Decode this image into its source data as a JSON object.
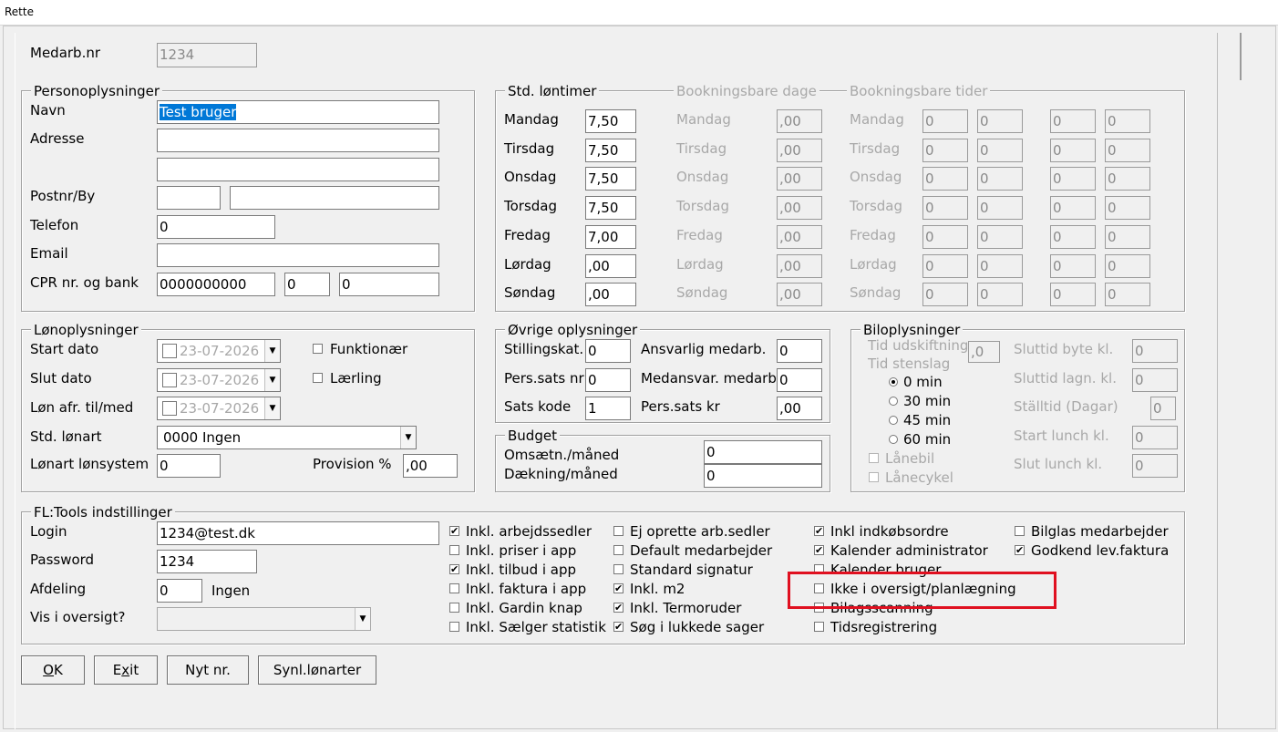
{
  "window": {
    "title": "Rette"
  },
  "header": {
    "medarb_label": "Medarb.nr",
    "medarb_value": "1234"
  },
  "person": {
    "title": "Personoplysninger",
    "navn_label": "Navn",
    "navn_value": "Test bruger",
    "adresse_label": "Adresse",
    "adresse1": "",
    "adresse2": "",
    "postnr_label": "Postnr/By",
    "postnr": "",
    "by": "",
    "telefon_label": "Telefon",
    "telefon": "0",
    "email_label": "Email",
    "email": "",
    "cpr_label": "CPR nr. og bank",
    "cpr": "0000000000",
    "bank1": "0",
    "bank2": "0"
  },
  "std": {
    "title": "Std. løntimer",
    "booking_days_title": "Bookningsbare dage",
    "booking_times_title": "Bookningsbare tider",
    "days": [
      {
        "label": "Mandag",
        "hours": "7,50",
        "book": ",00"
      },
      {
        "label": "Tirsdag",
        "hours": "7,50",
        "book": ",00"
      },
      {
        "label": "Onsdag",
        "hours": "7,50",
        "book": ",00"
      },
      {
        "label": "Torsdag",
        "hours": "7,50",
        "book": ",00"
      },
      {
        "label": "Fredag",
        "hours": "7,00",
        "book": ",00"
      },
      {
        "label": "Lørdag",
        "hours": ",00",
        "book": ",00"
      },
      {
        "label": "Søndag",
        "hours": ",00",
        "book": ",00"
      }
    ],
    "time_value": "0"
  },
  "lon": {
    "title": "Lønoplysninger",
    "start_label": "Start dato",
    "start_value": "23-07-2026",
    "slut_label": "Slut dato",
    "slut_value": "23-07-2026",
    "afr_label": "Løn afr. til/med",
    "afr_value": "23-07-2026",
    "funktionaer": "Funktionær",
    "laerling": "Lærling",
    "stdlonart_label": "Std. lønart",
    "stdlonart_value": "0000 Ingen",
    "lonsystem_label": "Lønart lønsystem",
    "lonsystem_value": "0",
    "provision_label": "Provision %",
    "provision_value": ",00"
  },
  "ovrige": {
    "title": "Øvrige oplysninger",
    "stilling_label": "Stillingskat.",
    "stilling": "0",
    "perssats_label": "Pers.sats nr",
    "perssats": "0",
    "satskode_label": "Sats kode",
    "satskode": "1",
    "ansvarlig_label": "Ansvarlig medarb.",
    "ansvarlig": "0",
    "medansvar_label": "Medansvar. medarb.",
    "medansvar": "0",
    "perssatskr_label": "Pers.sats kr",
    "perssatskr": ",00"
  },
  "budget": {
    "title": "Budget",
    "oms_label": "Omsætn./måned",
    "oms": "0",
    "daek_label": "Dækning/måned",
    "daek": "0"
  },
  "bil": {
    "title": "Biloplysninger",
    "udskift_label": "Tid udskiftning",
    "udskift": ",0",
    "stenslag_label": "Tid stenslag",
    "radios": [
      "0 min",
      "30 min",
      "45 min",
      "60 min"
    ],
    "laanebil": "Lånebil",
    "laanecykel": "Lånecykel",
    "byte_label": "Sluttid byte kl.",
    "byte": "0",
    "lagn_label": "Sluttid lagn. kl.",
    "lagn": "0",
    "staall_label": "Ställtid (Dagar)",
    "staall": "0",
    "startlunch_label": "Start lunch kl.",
    "startlunch": "0",
    "slutlunch_label": "Slut lunch kl.",
    "slutlunch": "0"
  },
  "fl": {
    "title": "FL:Tools indstillinger",
    "login_label": "Login",
    "login": "1234@test.dk",
    "password_label": "Password",
    "password": "1234",
    "afdeling_label": "Afdeling",
    "afdeling": "0",
    "afdeling_name": "Ingen",
    "vis_label": "Vis i oversigt?",
    "vis_value": "",
    "col1": [
      {
        "label": "Inkl. arbejdssedler",
        "checked": true
      },
      {
        "label": "Inkl. priser i app",
        "checked": false
      },
      {
        "label": "Inkl. tilbud i app",
        "checked": true
      },
      {
        "label": "Inkl. faktura i app",
        "checked": false
      },
      {
        "label": "Inkl. Gardin knap",
        "checked": false
      },
      {
        "label": "Inkl. Sælger statistik",
        "checked": false
      }
    ],
    "col2": [
      {
        "label": "Ej oprette arb.sedler",
        "checked": false
      },
      {
        "label": "Default medarbejder",
        "checked": false
      },
      {
        "label": "Standard signatur",
        "checked": false
      },
      {
        "label": "Inkl. m2",
        "checked": true
      },
      {
        "label": "Inkl. Termoruder",
        "checked": true
      },
      {
        "label": "Søg i lukkede sager",
        "checked": true
      }
    ],
    "col3": [
      {
        "label": "Inkl indkøbsordre",
        "checked": true
      },
      {
        "label": "Kalender administrator",
        "checked": true
      },
      {
        "label": "Kalender bruger",
        "checked": false
      },
      {
        "label": "Ikke i oversigt/planlægning",
        "checked": false
      },
      {
        "label": "Bilagsscanning",
        "checked": false
      },
      {
        "label": "Tidsregistrering",
        "checked": false
      }
    ],
    "col4": [
      {
        "label": "Bilglas medarbejder",
        "checked": false
      },
      {
        "label": "Godkend lev.faktura",
        "checked": true
      }
    ]
  },
  "buttons": {
    "ok": "OK",
    "exit": "Exit",
    "nyt": "Nyt nr.",
    "synl": "Synl.lønarter"
  },
  "colors": {
    "highlight": "#e01020",
    "selection": "#0078d7"
  }
}
